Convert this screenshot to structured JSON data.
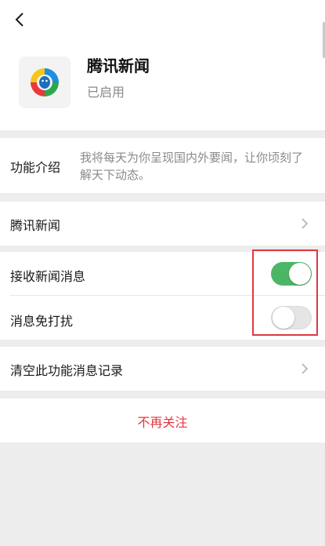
{
  "header": {
    "back_icon": "chevron-left-icon",
    "app_name": "腾讯新闻",
    "app_status": "已启用",
    "logo_icon": "tencent-news-logo-icon"
  },
  "intro": {
    "label": "功能介绍",
    "text": "我将每天为你呈现国内外要闻，让你顷刻了解天下动态。"
  },
  "account_row": {
    "label": "腾讯新闻"
  },
  "settings": {
    "receive_label": "接收新闻消息",
    "receive_on": true,
    "mute_label": "消息免打扰",
    "mute_on": false
  },
  "clear_row": {
    "label": "清空此功能消息记录"
  },
  "unfollow": {
    "label": "不再关注"
  },
  "colors": {
    "accent_green": "#4cb667",
    "danger_red": "#e0383e",
    "background": "#ededed"
  }
}
